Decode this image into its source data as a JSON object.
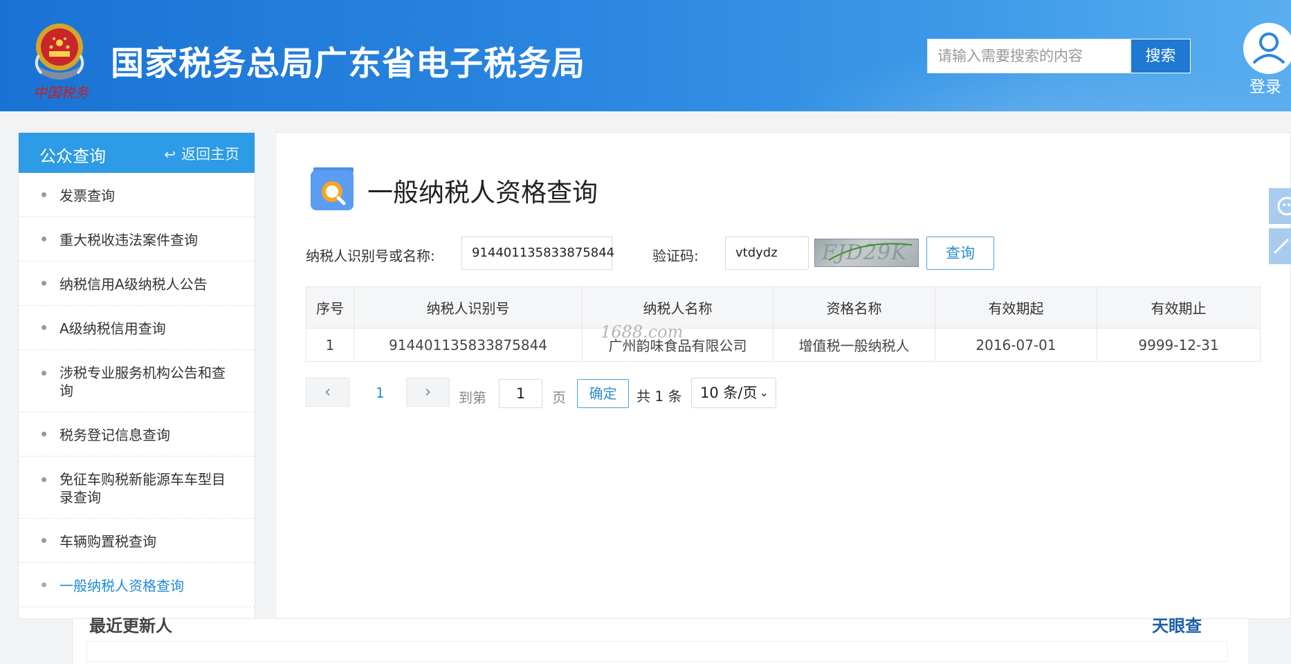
{
  "header": {
    "site_title": "国家税务总局广东省电子税务局",
    "emblem_icon": "tax-emblem-icon",
    "emblem_caption": "中国税务",
    "search_placeholder": "请输入需要搜索的内容",
    "search_button": "搜索",
    "login_label": "登录"
  },
  "sidebar": {
    "title": "公众查询",
    "back_label": "返回主页",
    "items": [
      {
        "label": "发票查询"
      },
      {
        "label": "重大税收违法案件查询"
      },
      {
        "label": "纳税信用A级纳税人公告"
      },
      {
        "label": "A级纳税信用查询"
      },
      {
        "label": "涉税专业服务机构公告和查询"
      },
      {
        "label": "税务登记信息查询"
      },
      {
        "label": "免征车购税新能源车车型目录查询"
      },
      {
        "label": "车辆购置税查询"
      },
      {
        "label": "一般纳税人资格查询"
      }
    ],
    "active_index": 8
  },
  "main": {
    "page_title": "一般纳税人资格查询",
    "form": {
      "taxpayer_label": "纳税人识别号或名称:",
      "taxpayer_value": "914401135833875844",
      "captcha_label": "验证码:",
      "captcha_value": "vtdydz",
      "captcha_image_text": "FJD29K",
      "query_button": "查询"
    },
    "table": {
      "headers": [
        "序号",
        "纳税人识别号",
        "纳税人名称",
        "资格名称",
        "有效期起",
        "有效期止"
      ],
      "rows": [
        [
          "1",
          "914401135833875844",
          "广州韵味食品有限公司",
          "增值税一般纳税人",
          "2016-07-01",
          "9999-12-31"
        ]
      ]
    },
    "pager": {
      "prev": "‹",
      "current_page": "1",
      "next": "›",
      "goto_label": "到第",
      "goto_value": "1",
      "page_unit": "页",
      "confirm": "确定",
      "total_text": "共 1 条",
      "page_size": "10 条/页"
    }
  },
  "watermark": "1688.com",
  "underlay": {
    "title_fragment": "最近更新人",
    "right_fragment": "天眼查"
  },
  "colors": {
    "header_blue": "#1a73d4",
    "sidebar_head": "#2d9be6",
    "active_link": "#1e8ad6"
  }
}
